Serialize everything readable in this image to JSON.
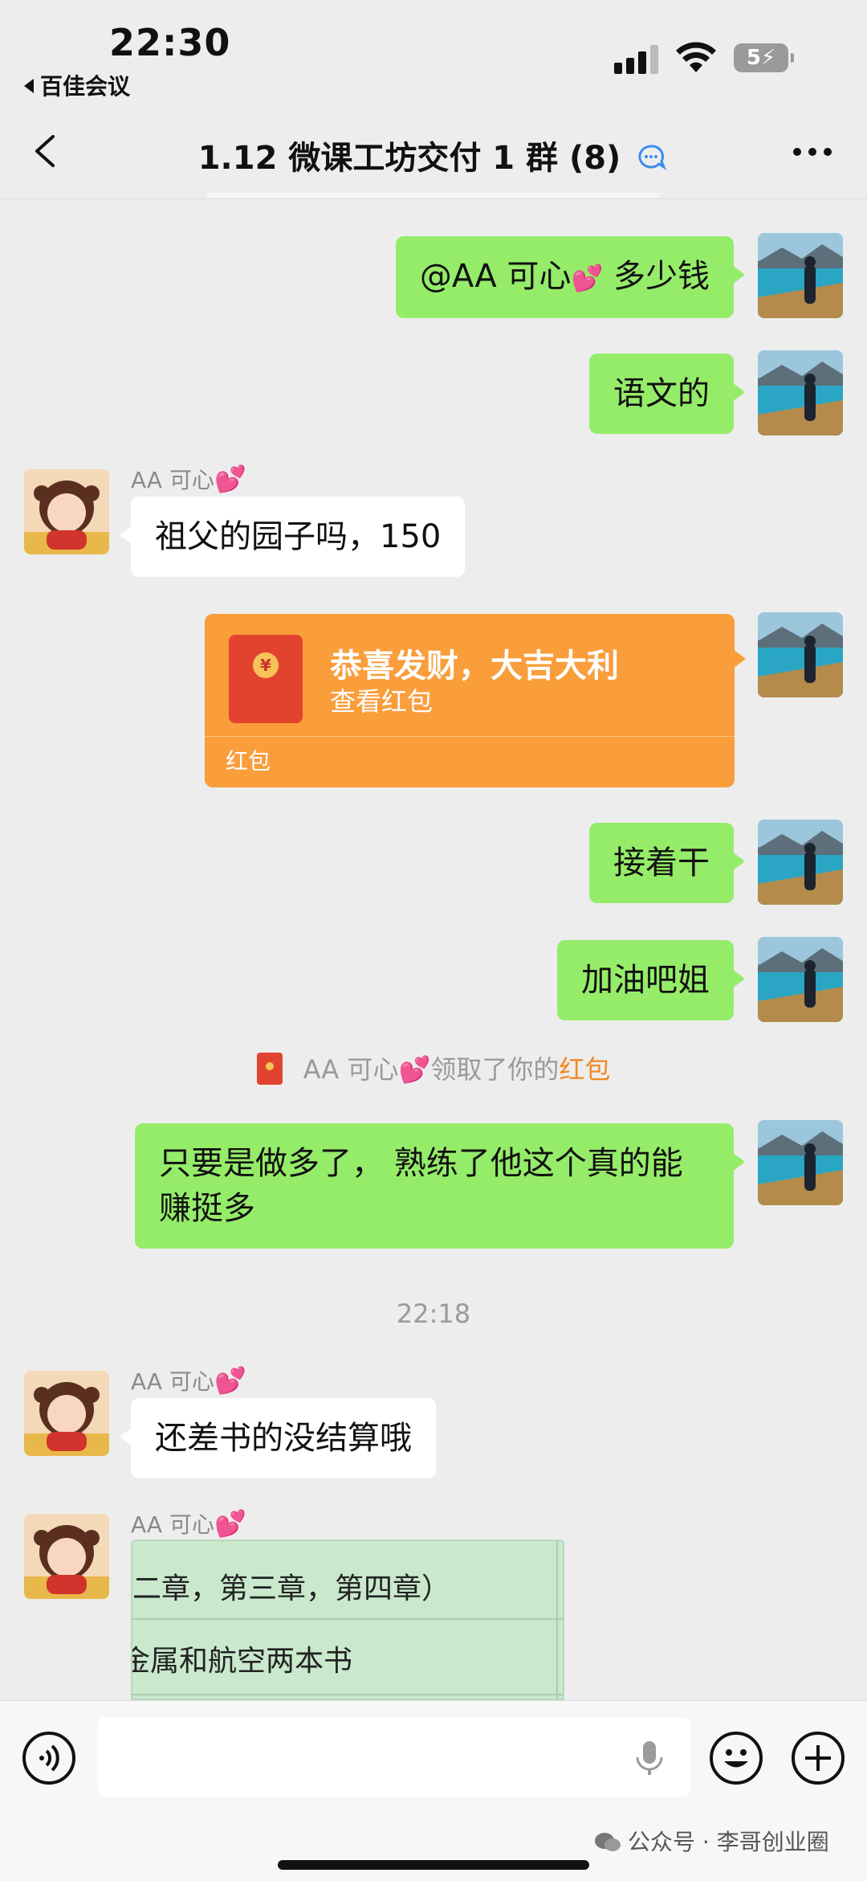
{
  "status_bar": {
    "time": "22:30",
    "back_app": "百佳会议",
    "battery": "5"
  },
  "nav": {
    "title": "1.12 微课工坊交付 1 群 (8)"
  },
  "contact": {
    "name": "AA 可心",
    "heart": "💕"
  },
  "messages": {
    "m1_prefix": "@AA 可心",
    "m1_suffix": " 多少钱",
    "m2": "语文的",
    "m3": "祖父的园子吗，150",
    "red_packet": {
      "title": "恭喜发财，大吉大利",
      "subtitle": "查看红包",
      "footer": "红包"
    },
    "m4": "接着干",
    "m5": "加油吧姐",
    "system_notice": {
      "name": "AA 可心",
      "action": "领取了你的",
      "link": "红包"
    },
    "m6": "只要是做多了， 熟练了他这个真的能赚挺多",
    "timestamp": "22:18",
    "m7": "还差书的没结算哦",
    "image_rows": [
      "二章，第三章，第四章）",
      "金属和航空两本书"
    ]
  },
  "watermark": {
    "source": "公众号",
    "dot": "·",
    "author": "李哥创业圈"
  },
  "colors": {
    "my_bubble": "#95ec69",
    "their_bubble": "#ffffff",
    "red_packet": "#fa9d3b",
    "background": "#ededed"
  },
  "icons": [
    "back-icon",
    "signal-icon",
    "wifi-icon",
    "battery-icon",
    "chevron-left-icon",
    "group-badge-icon",
    "more-icon",
    "red-packet-icon",
    "voice-icon",
    "mic-icon",
    "emoji-icon",
    "plus-icon",
    "wechat-icon"
  ]
}
